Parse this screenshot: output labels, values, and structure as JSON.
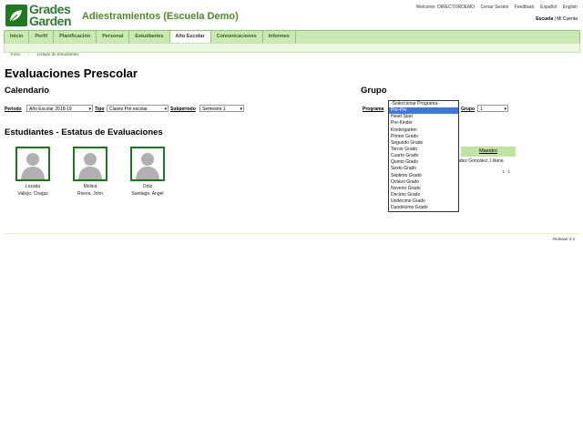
{
  "header": {
    "logo_line1": "Grades",
    "logo_line2": "Garden",
    "org_title": "Adiestramientos (Escuela Demo)",
    "welcome": "Welcome: DIRECTORDEMO",
    "logout": "Cerrar Sesión",
    "feedback": "Feedback",
    "lang_es": "Español",
    "lang_en": "English",
    "school": "Escuela",
    "my_account": "Mi Cuenta"
  },
  "nav": {
    "items": [
      "Inicio",
      "Perfil",
      "Planificación",
      "Personal",
      "Estudiantes",
      "Año Escolar",
      "Comunicaciones",
      "Informes"
    ],
    "active_index": 5
  },
  "breadcrumb": {
    "home": "Inicio",
    "current": "Listado de Estudiantes"
  },
  "page": {
    "title": "Evaluaciones Prescolar",
    "calendar_heading": "Calendario",
    "group_heading": "Grupo",
    "periodo_label": "Periodo",
    "periodo_value": "Año Escolar 2018-19",
    "tipo_label": "Tipo",
    "tipo_value": "Clases Pre escolar",
    "subperiodo_label": "Subperiodo",
    "subperiodo_value": "Semestre 1",
    "programa_label": "Programa",
    "grupo_label": "Grupo",
    "grupo_value": "1",
    "students_heading": "Estudiantes - Estatus de Evaluaciones"
  },
  "students": [
    {
      "last": "Lozada",
      "first": "Vallejo, Chagui"
    },
    {
      "last": "Molina",
      "first": "Rivera, John"
    },
    {
      "last": "Ortiz",
      "first": "Santiago, Angel"
    }
  ],
  "table": {
    "header": "Maestro",
    "teacher": "ndez González, Liliana",
    "pager": "1 - 1"
  },
  "programa_dropdown": {
    "options": [
      "-Seleccionar Programa-",
      "Pre-Pre",
      "Head Start",
      "Pre-Kinder",
      "Kindergarten",
      "Primer Grado",
      "Segundo Grado",
      "Tercer Grado",
      "Cuarto Grado",
      "Quinto Grado",
      "Sexto Grado",
      "Séptimo Grado",
      "Octavo Grado",
      "Noveno Grado",
      "Decimo Grado",
      "Undécimo Grado",
      "Duodécimo Grado"
    ],
    "highlighted_index": 1
  },
  "footer": {
    "release": "Release 3.3"
  },
  "colors": {
    "brand_green": "#1f7a1f",
    "nav_bg": "#c9eab0",
    "highlight": "#3b78d8"
  }
}
